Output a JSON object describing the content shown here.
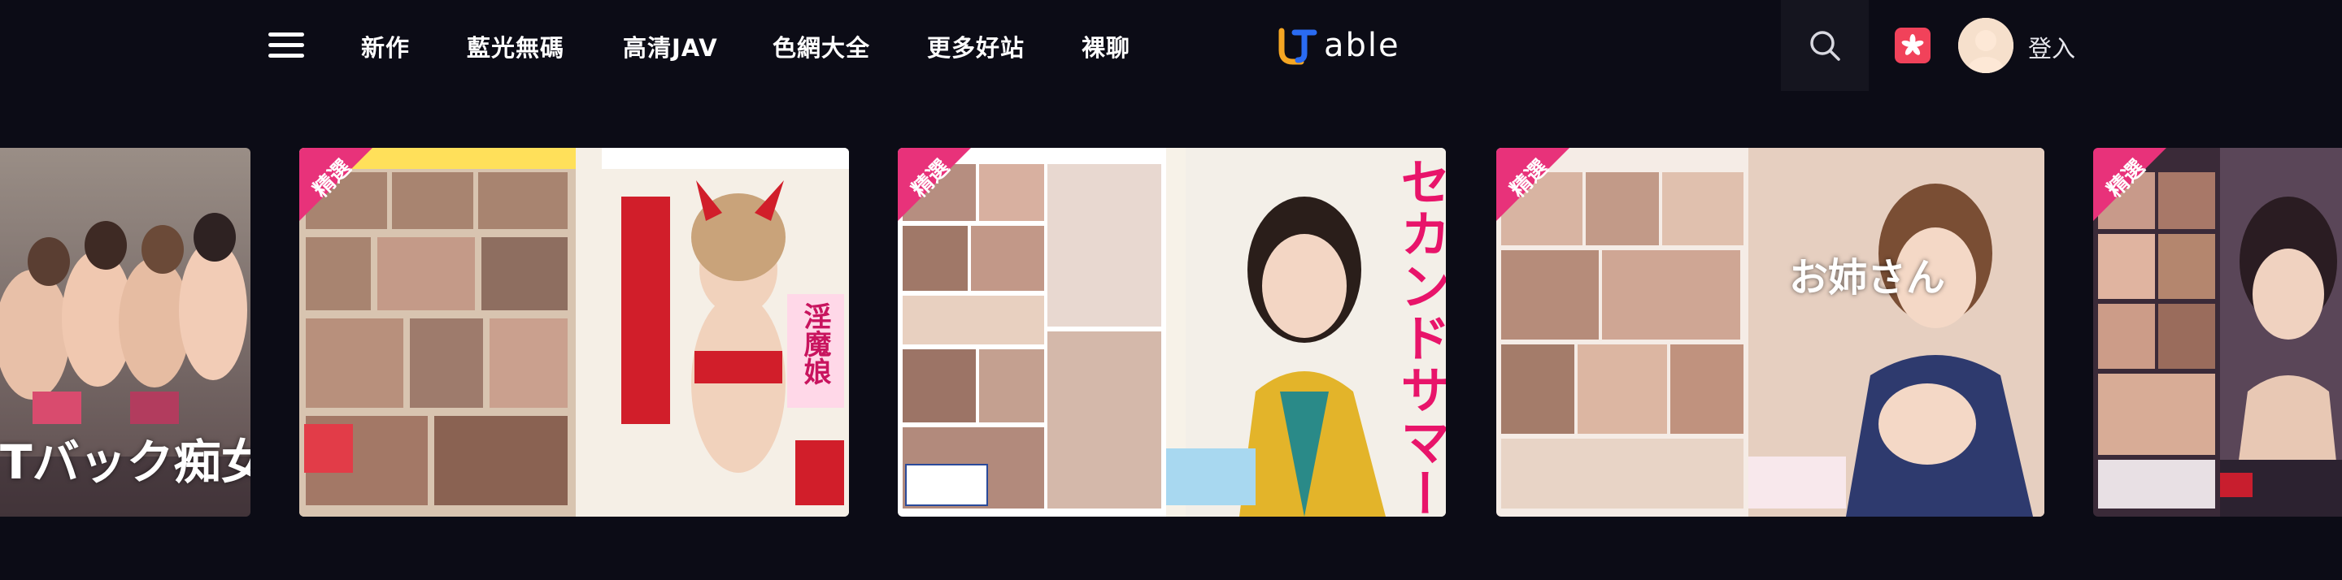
{
  "header": {
    "nav": [
      {
        "label": "新作"
      },
      {
        "label": "藍光無碼"
      },
      {
        "label": "高清JAV"
      },
      {
        "label": "色網大全"
      },
      {
        "label": "更多好站"
      },
      {
        "label": "裸聊"
      }
    ],
    "logo_text": "able",
    "login_label": "登入",
    "icons": {
      "menu": "hamburger-menu-icon",
      "search": "search-icon",
      "language": "hk-flag-icon"
    }
  },
  "cards": [
    {
      "badge": "",
      "cover_text": "Tバック痴女"
    },
    {
      "badge": "精選",
      "cover_text": "淫魔娘"
    },
    {
      "badge": "精選",
      "cover_text": "セカンドサマー"
    },
    {
      "badge": "精選",
      "cover_text": "お姉さん"
    },
    {
      "badge": "精選",
      "cover_text": ""
    }
  ],
  "colors": {
    "background": "#0c0c16",
    "badge": "#e8327a",
    "logo_accent": "#2a6bf2",
    "logo_orange": "#f5a623",
    "flag_red": "#f1425a"
  }
}
